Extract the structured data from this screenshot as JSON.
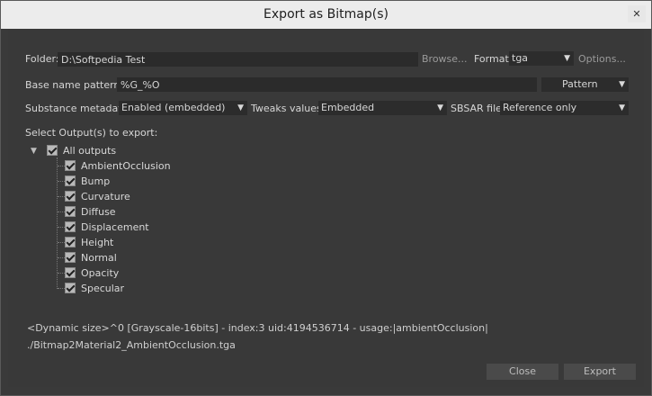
{
  "window": {
    "title": "Export as Bitmap(s)",
    "close_glyph": "✕"
  },
  "folder": {
    "label": "Folder:",
    "value": "D:\\Softpedia Test",
    "browse": "Browse...",
    "format_label": "Format:",
    "format_value": "tga",
    "options": "Options..."
  },
  "basename": {
    "label": "Base name pattern:",
    "value": "%G_%O",
    "pattern_button": "Pattern"
  },
  "metadata": {
    "label": "Substance metadata:",
    "value": "Enabled (embedded)",
    "tweaks_label": "Tweaks values:",
    "tweaks_value": "Embedded",
    "sbsar_label": "SBSAR file:",
    "sbsar_value": "Reference only"
  },
  "outputs": {
    "label": "Select Output(s) to export:",
    "all_label": "All outputs",
    "items": [
      "AmbientOcclusion",
      "Bump",
      "Curvature",
      "Diffuse",
      "Displacement",
      "Height",
      "Normal",
      "Opacity",
      "Specular"
    ]
  },
  "info": {
    "line1": "<Dynamic size>^0 [Grayscale-16bits] - index:3 uid:4194536714 - usage:|ambientOcclusion|",
    "line2": "./Bitmap2Material2_AmbientOcclusion.tga"
  },
  "buttons": {
    "close": "Close",
    "export": "Export"
  }
}
